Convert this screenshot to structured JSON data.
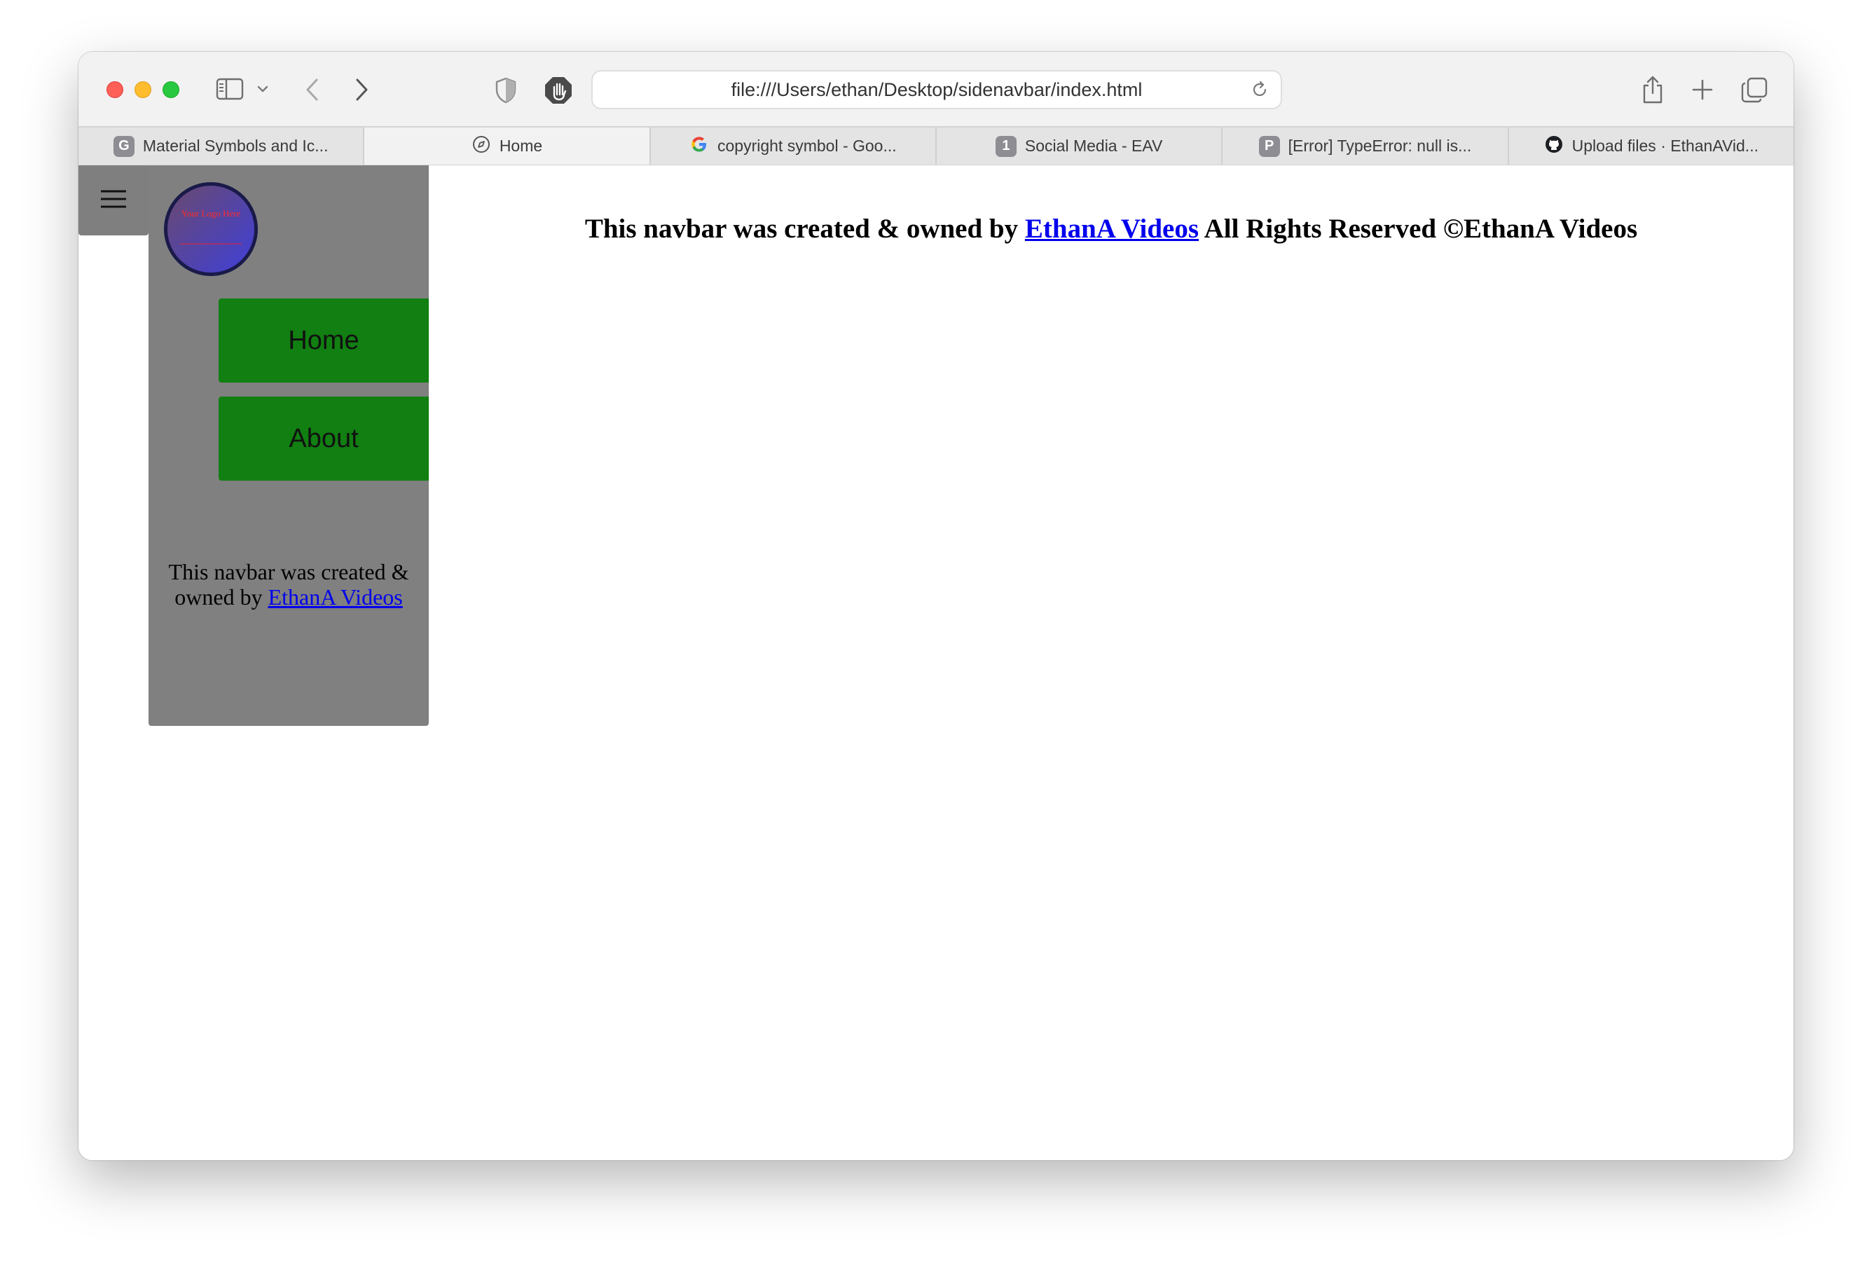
{
  "browser": {
    "address_url": "file:///Users/ethan/Desktop/sidenavbar/index.html",
    "tabs": [
      {
        "label": "Material Symbols and Ic...",
        "favicon": "G"
      },
      {
        "label": "Home",
        "favicon": "compass-icon"
      },
      {
        "label": "copyright symbol - Goo...",
        "favicon": "google-icon"
      },
      {
        "label": "Social Media - EAV",
        "favicon": "1"
      },
      {
        "label": "[Error] TypeError: null is...",
        "favicon": "P"
      },
      {
        "label": "Upload files · EthanAVid...",
        "favicon": "github-icon"
      }
    ],
    "active_tab": 1
  },
  "sidenav": {
    "logo_text": "Your Logo Here",
    "items": [
      {
        "label": "Home"
      },
      {
        "label": "About"
      }
    ],
    "footer_text": "This navbar was created & owned by ",
    "footer_link": "EthanA Videos"
  },
  "main": {
    "heading_prefix": "This navbar was created & owned by ",
    "heading_link": "EthanA Videos",
    "heading_suffix": " All Rights Reserved ©EthanA Videos"
  },
  "colors": {
    "sidenav_bg": "#808080",
    "nav_button_bg": "#117f11",
    "link": "#0000ee"
  }
}
